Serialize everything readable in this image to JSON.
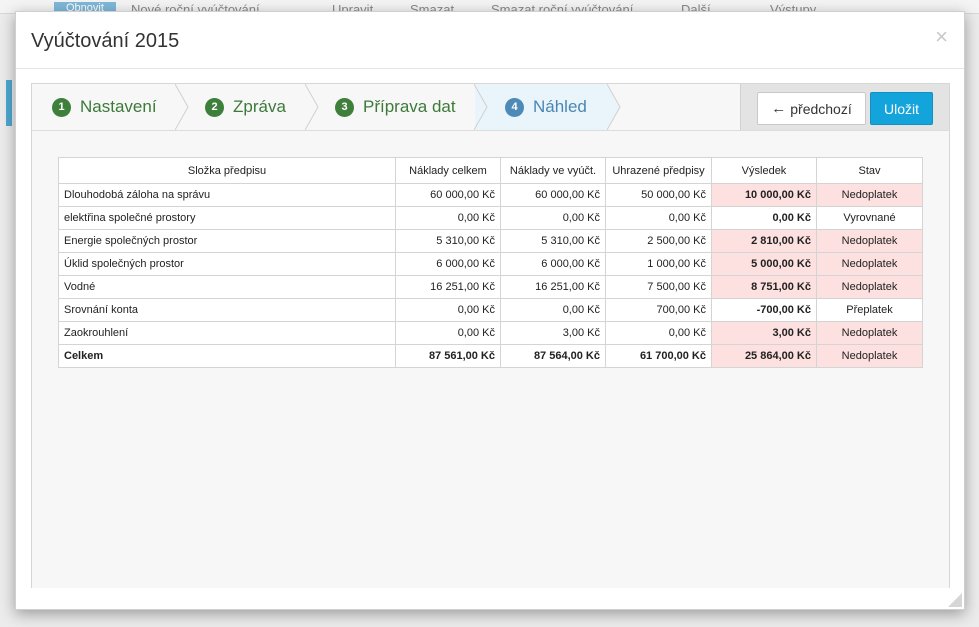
{
  "background": {
    "toolbar_items": [
      "Obnovit",
      "Nové roční vyúčtování",
      "Upravit",
      "Smazat",
      "Smazat roční vyúčtování",
      "Další",
      "Výstupy"
    ]
  },
  "modal": {
    "title": "Vyúčtování 2015",
    "close_icon": "close-icon"
  },
  "steps": [
    {
      "number": "1",
      "label": "Nastavení",
      "active": false
    },
    {
      "number": "2",
      "label": "Zpráva",
      "active": false
    },
    {
      "number": "3",
      "label": "Příprava dat",
      "active": false
    },
    {
      "number": "4",
      "label": "Náhled",
      "active": true
    }
  ],
  "actions": {
    "prev_label": "předchozí",
    "prev_icon": "arrow-left-icon",
    "save_label": "Uložit"
  },
  "table": {
    "headers": [
      "Složka předpisu",
      "Náklady celkem",
      "Náklady ve vyúčt.",
      "Uhrazené předpisy",
      "Výsledek",
      "Stav"
    ],
    "rows": [
      {
        "name": "Dlouhodobá záloha na správu",
        "cost_total": "60 000,00 Kč",
        "cost_billed": "60 000,00 Kč",
        "paid": "50 000,00 Kč",
        "result": "10 000,00 Kč",
        "state": "Nedoplatek",
        "highlight": true
      },
      {
        "name": "elektřina společné prostory",
        "cost_total": "0,00 Kč",
        "cost_billed": "0,00 Kč",
        "paid": "0,00 Kč",
        "result": "0,00 Kč",
        "state": "Vyrovnané",
        "highlight": false
      },
      {
        "name": "Energie společných prostor",
        "cost_total": "5 310,00 Kč",
        "cost_billed": "5 310,00 Kč",
        "paid": "2 500,00 Kč",
        "result": "2 810,00 Kč",
        "state": "Nedoplatek",
        "highlight": true
      },
      {
        "name": "Úklid společných prostor",
        "cost_total": "6 000,00 Kč",
        "cost_billed": "6 000,00 Kč",
        "paid": "1 000,00 Kč",
        "result": "5 000,00 Kč",
        "state": "Nedoplatek",
        "highlight": true
      },
      {
        "name": "Vodné",
        "cost_total": "16 251,00 Kč",
        "cost_billed": "16 251,00 Kč",
        "paid": "7 500,00 Kč",
        "result": "8 751,00 Kč",
        "state": "Nedoplatek",
        "highlight": true
      },
      {
        "name": "Srovnání konta",
        "cost_total": "0,00 Kč",
        "cost_billed": "0,00 Kč",
        "paid": "700,00 Kč",
        "result": "-700,00 Kč",
        "state": "Přeplatek",
        "highlight": false
      },
      {
        "name": "Zaokrouhlení",
        "cost_total": "0,00 Kč",
        "cost_billed": "3,00 Kč",
        "paid": "0,00 Kč",
        "result": "3,00 Kč",
        "state": "Nedoplatek",
        "highlight": true
      }
    ],
    "total": {
      "name": "Celkem",
      "cost_total": "87 561,00 Kč",
      "cost_billed": "87 564,00 Kč",
      "paid": "61 700,00 Kč",
      "result": "25 864,00 Kč",
      "state": "Nedoplatek",
      "highlight": true
    }
  },
  "colors": {
    "step_green": "#3f7f3c",
    "step_active_blue": "#4e8ab8",
    "save_button": "#14a4dc",
    "result_highlight": "#fde0e0"
  }
}
